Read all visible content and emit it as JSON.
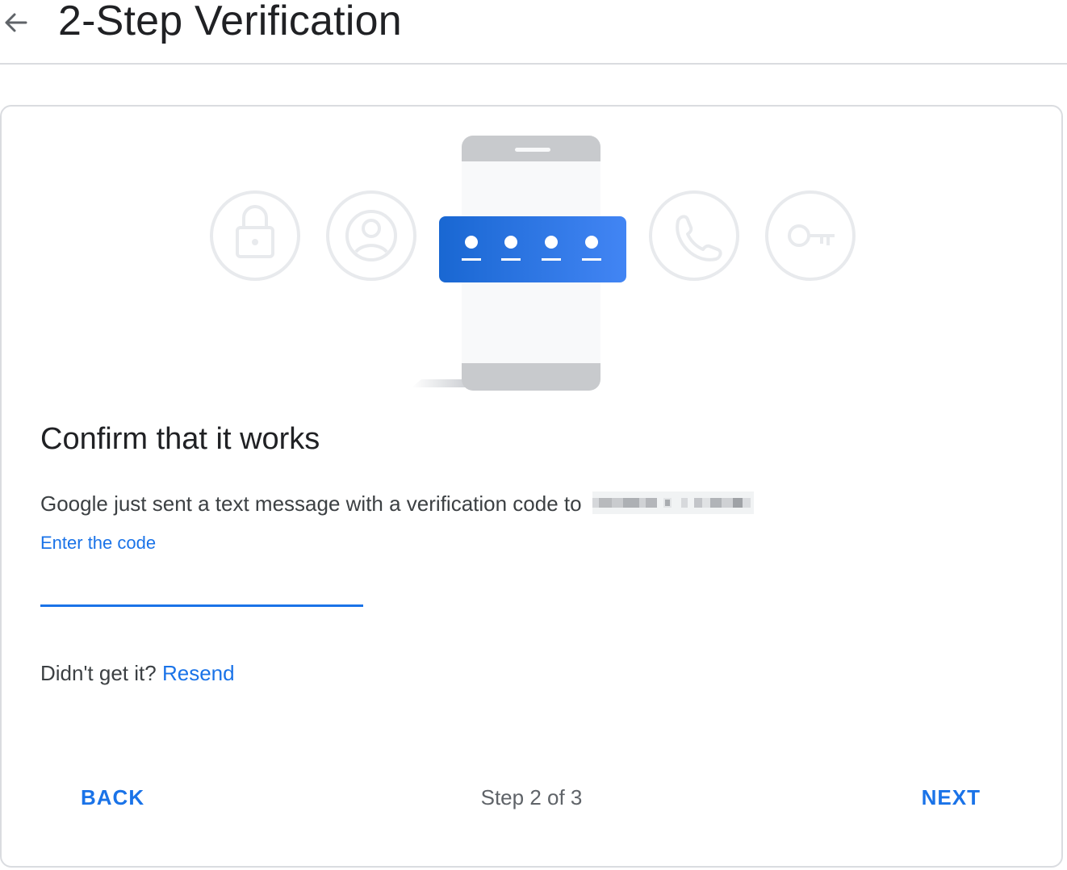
{
  "header": {
    "title": "2-Step Verification",
    "back_icon": "arrow-back-icon"
  },
  "illustration": {
    "circle_icons": [
      "lock-icon",
      "account-icon",
      "phone-icon",
      "key-icon"
    ],
    "code_digits": 4,
    "accent_color": "#1a73e8"
  },
  "main": {
    "title": "Confirm that it works",
    "message": "Google just sent a text message with a verification code to",
    "code_label": "Enter the code",
    "code_value": "",
    "resend_prompt": "Didn't get it?",
    "resend_label": "Resend"
  },
  "footer": {
    "back_label": "BACK",
    "step_text": "Step 2 of 3",
    "next_label": "NEXT"
  },
  "colors": {
    "link": "#1a73e8",
    "text_primary": "#202124",
    "text_secondary": "#3c4043",
    "border": "#dadce0"
  }
}
